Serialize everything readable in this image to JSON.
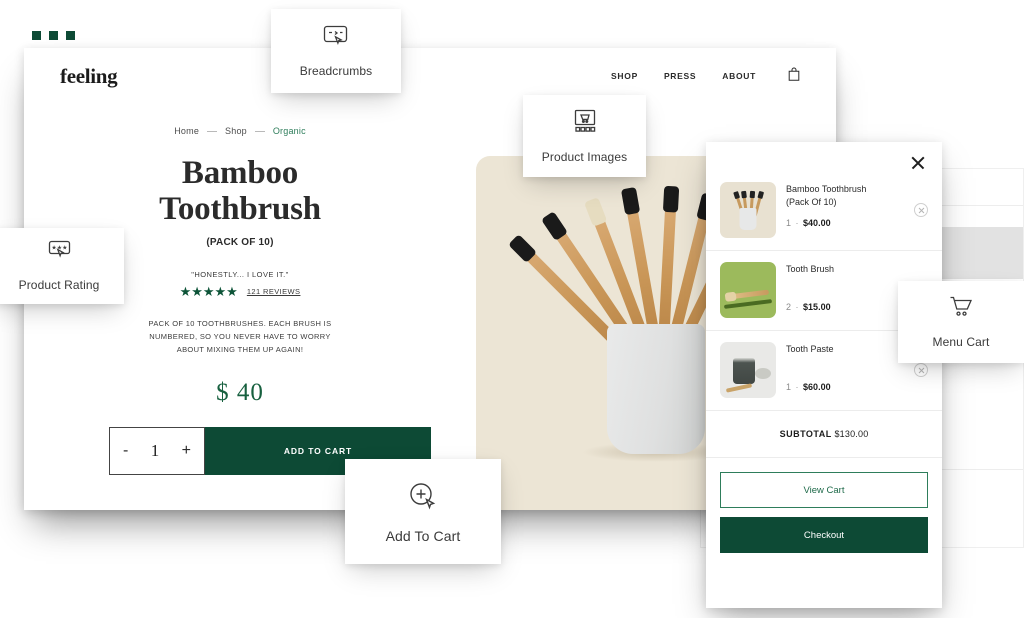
{
  "window_chrome": {
    "dots": [
      "dot-1",
      "dot-2",
      "dot-3"
    ]
  },
  "header": {
    "brand": "feeling",
    "nav": [
      {
        "label": "SHOP"
      },
      {
        "label": "PRESS"
      },
      {
        "label": "ABOUT"
      }
    ],
    "bag_icon": "shopping-bag-icon"
  },
  "breadcrumbs": [
    {
      "label": "Home",
      "active": false
    },
    {
      "label": "Shop",
      "active": false
    },
    {
      "label": "Organic",
      "active": true
    }
  ],
  "product": {
    "title_line1": "Bamboo",
    "title_line2": "Toothbrush",
    "subtitle": "(PACK OF 10)",
    "quote": "\"HONESTLY... I LOVE IT.\"",
    "stars": "★★★★★",
    "star_count": 5,
    "reviews_label": "121 REVIEWS",
    "description": "PACK OF 10 TOOTHBRUSHES. EACH BRUSH IS NUMBERED, SO YOU NEVER HAVE TO WORRY ABOUT MIXING THEM UP AGAIN!",
    "price": "$ 40",
    "quantity": "1",
    "decrement_label": "-",
    "increment_label": "+",
    "add_to_cart_label": "ADD TO CART",
    "hero_alt": "bamboo-toothbrushes-in-ceramic-cup"
  },
  "cart": {
    "close_icon": "close-icon",
    "items": [
      {
        "name": "Bamboo Toothbrush",
        "variant": "(Pack Of 10)",
        "qty": "1",
        "separator": "·",
        "price": "$40.00",
        "thumb": "toothbrush-cup-thumbnail"
      },
      {
        "name": "Tooth Brush",
        "variant": "",
        "qty": "2",
        "separator": "·",
        "price": "$15.00",
        "thumb": "green-toothbrush-thumbnail"
      },
      {
        "name": "Tooth Paste",
        "variant": "",
        "qty": "1",
        "separator": "·",
        "price": "$60.00",
        "thumb": "toothpaste-jar-thumbnail"
      }
    ],
    "subtotal_label": "SUBTOTAL",
    "subtotal_value": "$130.00",
    "view_cart_label": "View Cart",
    "checkout_label": "Checkout"
  },
  "callouts": [
    {
      "id": "breadcrumbs",
      "label": "Breadcrumbs",
      "icon": "breadcrumbs-cursor-icon"
    },
    {
      "id": "product-images",
      "label": "Product Images",
      "icon": "gallery-cart-icon"
    },
    {
      "id": "product-rating",
      "label": "Product Rating",
      "icon": "rating-stars-cursor-icon"
    },
    {
      "id": "menu-cart",
      "label": "Menu Cart",
      "icon": "shopping-cart-icon"
    },
    {
      "id": "add-to-cart",
      "label": "Add To Cart",
      "icon": "plus-circle-cursor-icon"
    }
  ],
  "colors": {
    "brand_green_dark": "#0d4a35",
    "brand_green": "#2e7d5b",
    "price_green": "#17603f",
    "hero_cream": "#ece5d5",
    "text_dark": "#2b2b2b",
    "thumb_green": "#9cba5c"
  }
}
